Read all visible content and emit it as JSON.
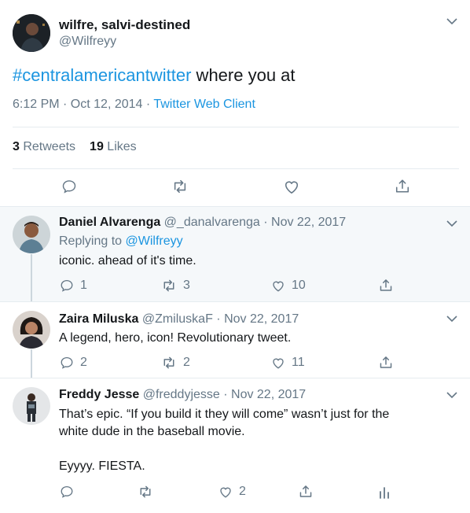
{
  "tweet": {
    "name": "wilfre, salvi-destined",
    "handle": "@Wilfreyy",
    "hashtag": "#centralamericantwitter",
    "text_rest": " where you at",
    "time": "6:12 PM · Oct 12, 2014 · ",
    "client": "Twitter Web Client",
    "retweets_count": "3",
    "retweets_label": " Retweets",
    "likes_count": "19",
    "likes_label": " Likes"
  },
  "replies": [
    {
      "name": "Daniel Alvarenga",
      "handle_date": " @_danalvarenga · Nov 22, 2017",
      "replying_prefix": "Replying to ",
      "replying_to": "@Wilfreyy",
      "text": "iconic. ahead of it's time.",
      "replies": "1",
      "retweets": "3",
      "likes": "10"
    },
    {
      "name": "Zaira Miluska",
      "handle_date": " @ZmiluskaF · Nov 22, 2017",
      "text": "A legend, hero, icon! Revolutionary tweet.",
      "replies": "2",
      "retweets": "2",
      "likes": "11"
    },
    {
      "name": "Freddy Jesse",
      "handle_date": " @freddyjesse · Nov 22, 2017",
      "text_line1": "That’s epic. “If you build it they will come” wasn’t just for the",
      "text_line2": "white dude in the baseball movie.",
      "text_line3": "Eyyyy. FIESTA.",
      "likes": "2"
    }
  ],
  "colors": {
    "link": "#1b95e0",
    "secondary": "#657786",
    "highlight_bg": "#f5f8fa",
    "divider": "#e6ecf0"
  }
}
